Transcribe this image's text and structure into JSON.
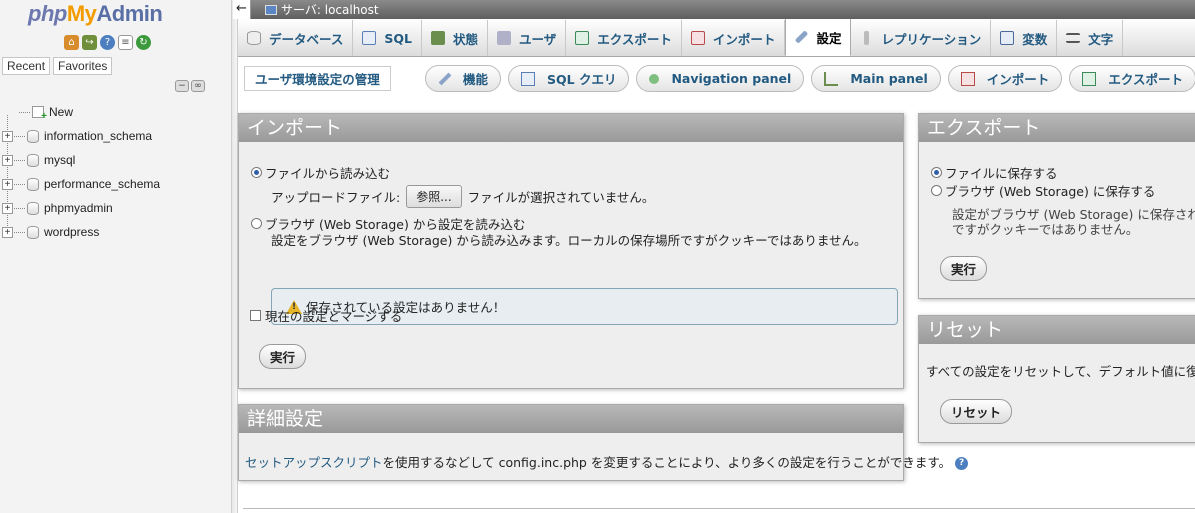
{
  "nav": {
    "logo": {
      "php": "php",
      "my": "My",
      "admin": "Admin"
    },
    "icons": [
      "home-icon",
      "exit-icon",
      "help-icon",
      "docs-icon",
      "reload-icon"
    ],
    "tabs": [
      "Recent",
      "Favorites"
    ],
    "tree": [
      {
        "name": "New",
        "kind": "new"
      },
      {
        "name": "information_schema",
        "kind": "db"
      },
      {
        "name": "mysql",
        "kind": "db"
      },
      {
        "name": "performance_schema",
        "kind": "db"
      },
      {
        "name": "phpmyadmin",
        "kind": "db"
      },
      {
        "name": "wordpress",
        "kind": "db"
      }
    ]
  },
  "topbar": {
    "server": "サーバ: localhost"
  },
  "tabs": [
    {
      "label": "データベース",
      "icon": "database-icon",
      "color": "#8a8a8a"
    },
    {
      "label": "SQL",
      "icon": "sql-icon",
      "color": "#5a7fb5"
    },
    {
      "label": "状態",
      "icon": "status-icon",
      "color": "#6b8e4e"
    },
    {
      "label": "ユーザ",
      "icon": "users-icon",
      "color": "#7a7a9a"
    },
    {
      "label": "エクスポート",
      "icon": "export-icon",
      "color": "#3a8a5a"
    },
    {
      "label": "インポート",
      "icon": "import-icon",
      "color": "#b84a4a"
    },
    {
      "label": "設定",
      "icon": "wrench-icon",
      "color": "#5a7fb5",
      "active": true
    },
    {
      "label": "レプリケーション",
      "icon": "replication-icon",
      "color": "#999999"
    },
    {
      "label": "変数",
      "icon": "variables-icon",
      "color": "#4a6a9a"
    },
    {
      "label": "文字",
      "icon": "charset-icon",
      "color": "#555555"
    }
  ],
  "subtabs": {
    "manage": "ユーザ環境設定の管理",
    "items": [
      {
        "label": "機能",
        "icon": "wrench-icon",
        "color": "#5a7fb5"
      },
      {
        "label": "SQL クエリ",
        "icon": "sql-icon",
        "color": "#5a7fb5"
      },
      {
        "label": "Navigation panel",
        "icon": "navigation-icon",
        "color": "#4a9a4a"
      },
      {
        "label": "Main panel",
        "icon": "main-panel-icon",
        "color": "#6b8e4e"
      },
      {
        "label": "インポート",
        "icon": "import-icon",
        "color": "#b84a4a"
      },
      {
        "label": "エクスポート",
        "icon": "export-icon",
        "color": "#3a8a5a"
      }
    ]
  },
  "import_panel": {
    "title": "インポート",
    "from_file": "ファイルから読み込む",
    "upload_label": "アップロードファイル:",
    "browse_label": "参照...",
    "no_file": "ファイルが選択されていません。",
    "from_browser": "ブラウザ (Web Storage) から設定を読み込む",
    "browser_desc": "設定をブラウザ (Web Storage) から読み込みます。ローカルの保存場所ですがクッキーではありません。",
    "warning": "保存されている設定はありません！",
    "merge": "現在の設定とマージする",
    "go": "実行"
  },
  "export_panel": {
    "title": "エクスポート",
    "to_file": "ファイルに保存する",
    "to_browser": "ブラウザ (Web Storage) に保存する",
    "desc_line1": "設定がブラウザ (Web Storage) に保存されま",
    "desc_line2": "ですがクッキーではありません。",
    "go": "実行"
  },
  "reset_panel": {
    "title": "リセット",
    "desc": "すべての設定をリセットして、デフォルト値に復元し",
    "button": "リセット"
  },
  "advanced_panel": {
    "title": "詳細設定",
    "link": "セットアップスクリプト",
    "text": "を使用するなどして config.inc.php を変更することにより、より多くの設定を行うことができます。"
  }
}
